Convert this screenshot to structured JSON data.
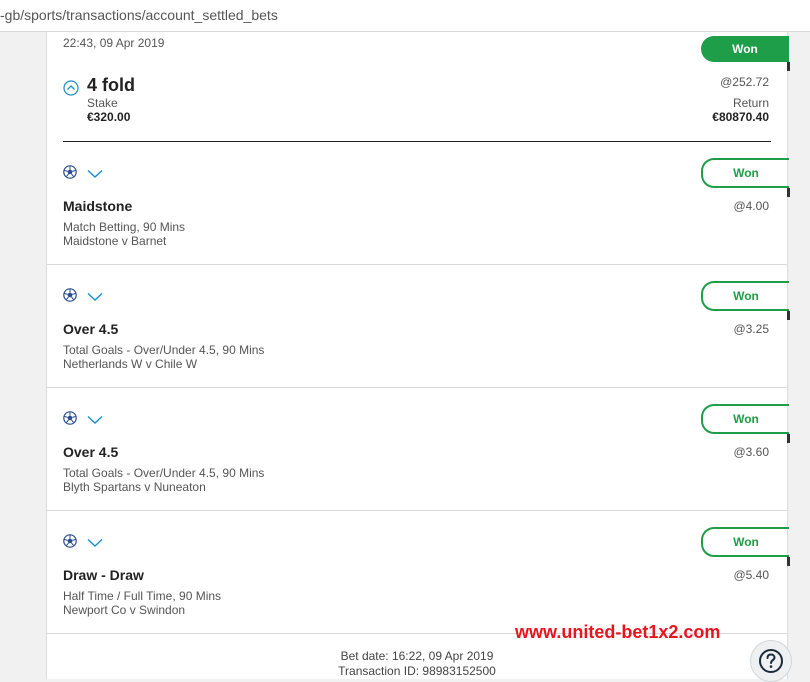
{
  "browser": {
    "url": "-gb/sports/transactions/account_settled_bets"
  },
  "bet": {
    "datetime": "22:43, 09 Apr 2019",
    "status": "Won",
    "title": "4 fold",
    "odds": "@252.72",
    "stake_label": "Stake",
    "stake_value": "€320.00",
    "return_label": "Return",
    "return_value": "€80870.40"
  },
  "selections": [
    {
      "status": "Won",
      "name": "Maidstone",
      "market": "Match Betting, 90 Mins",
      "event": "Maidstone v Barnet",
      "odds": "@4.00",
      "sport_icon": "football-icon"
    },
    {
      "status": "Won",
      "name": "Over 4.5",
      "market": "Total Goals - Over/Under 4.5, 90 Mins",
      "event": "Netherlands W v Chile W",
      "odds": "@3.25",
      "sport_icon": "football-icon"
    },
    {
      "status": "Won",
      "name": "Over 4.5",
      "market": "Total Goals - Over/Under 4.5, 90 Mins",
      "event": "Blyth Spartans v Nuneaton",
      "odds": "@3.60",
      "sport_icon": "football-icon"
    },
    {
      "status": "Won",
      "name": "Draw - Draw",
      "market": "Half Time / Full Time, 90 Mins",
      "event": "Newport Co v Swindon",
      "odds": "@5.40",
      "sport_icon": "football-icon"
    }
  ],
  "footer": {
    "bet_date": "Bet date: 16:22, 09 Apr 2019",
    "transaction_id": "Transaction ID: 98983152500"
  },
  "watermark": "www.united-bet1x2.com",
  "colors": {
    "won_green": "#1e9e48",
    "accent_blue": "#1a8fc9",
    "watermark_red": "#e8141e"
  }
}
